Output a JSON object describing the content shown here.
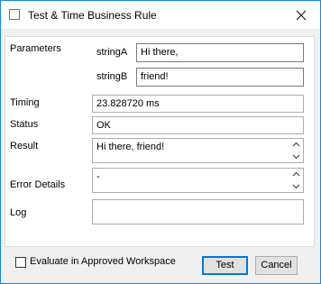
{
  "window": {
    "title": "Test & Time Business Rule",
    "accent_color": "#1c86d8",
    "icons": [
      "window-icon",
      "close-icon"
    ]
  },
  "parameters": {
    "label": "Parameters",
    "items": [
      {
        "name": "stringA",
        "value": "Hi there,"
      },
      {
        "name": "stringB",
        "value": "friend!"
      }
    ]
  },
  "timing": {
    "label": "Timing",
    "value": "23.828720 ms"
  },
  "status": {
    "label": "Status",
    "value": "OK"
  },
  "result": {
    "label": "Result",
    "value": "Hi there, friend!"
  },
  "error_details": {
    "label": "Error Details",
    "value": "-"
  },
  "log": {
    "label": "Log",
    "value": ""
  },
  "evaluate_checkbox": {
    "label": "Evaluate in Approved Workspace",
    "checked": false
  },
  "buttons": {
    "test": "Test",
    "cancel": "Cancel"
  }
}
